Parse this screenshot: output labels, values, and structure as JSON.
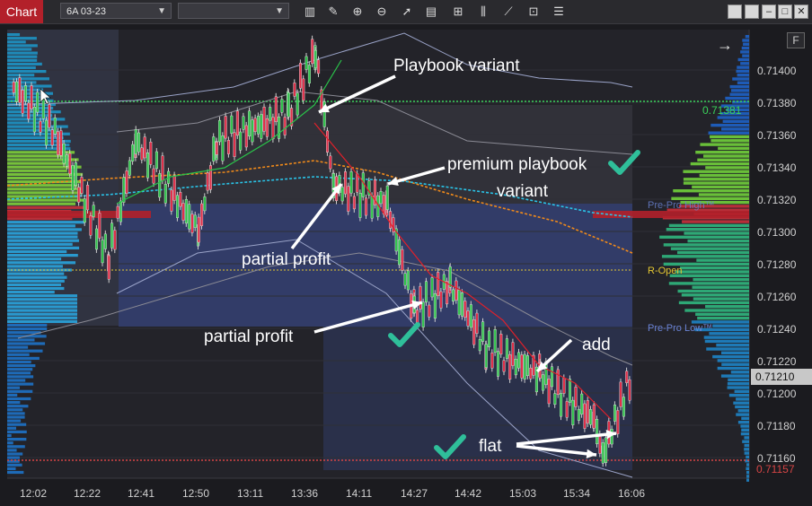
{
  "toolbar": {
    "tab_label": "Chart",
    "instrument": "6A 03-23",
    "interval": "",
    "tools": [
      "bar-type-icon",
      "draw-pencil-icon",
      "zoom-in-icon",
      "zoom-out-icon",
      "pointer-icon",
      "data-box-icon",
      "properties-icon",
      "indicators-icon",
      "strategies-icon",
      "chart-style-icon",
      "text-list-icon"
    ]
  },
  "window": {
    "f_label": "F"
  },
  "axis": {
    "prices": [
      "0.71400",
      "0.71380",
      "0.71360",
      "0.71340",
      "0.71320",
      "0.71300",
      "0.71280",
      "0.71260",
      "0.71240",
      "0.71220",
      "0.71200",
      "0.71180",
      "0.71160"
    ],
    "current_price": "0.71210",
    "green_level": "0.71381",
    "bottom_level": "0.71157",
    "times": [
      "12:02",
      "12:22",
      "12:41",
      "12:50",
      "13:11",
      "13:36",
      "14:11",
      "14:27",
      "14:42",
      "15:03",
      "15:34",
      "16:06"
    ]
  },
  "levels": {
    "pre_pro_high": "Pre-Pro High™",
    "r_open": "R-Open",
    "pre_pro_low": "Pre-Pro Low™"
  },
  "annotations": {
    "playbook_variant": "Playbook variant",
    "premium_playbook": "premium playbook",
    "variant": "variant",
    "partial_profit_1": "partial profit",
    "partial_profit_2": "partial profit",
    "add": "add",
    "flat": "flat"
  },
  "colors": {
    "background": "#1b1b1f",
    "bull": "#2fc24a",
    "bear": "#e0304a",
    "level_green": "#3ad35a",
    "level_red": "#d64545",
    "r_open": "#e6c832",
    "pre_pro": "#6b84d6"
  }
}
